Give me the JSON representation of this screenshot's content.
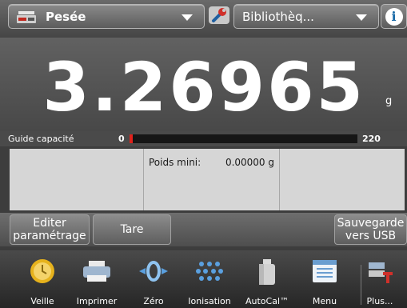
{
  "topbar": {
    "app_label": "Pesée",
    "library_label": "Bibliothèq...",
    "wrench_icon": "wrench-icon",
    "info_icon": "info-icon",
    "info_glyph": "i"
  },
  "weight": {
    "value": "3.26965",
    "unit": "g"
  },
  "capacity": {
    "label": "Guide capacité",
    "min": "0",
    "max": "220",
    "fill_fraction": 0.015,
    "fill_color": "#e0221c"
  },
  "info_panel": {
    "min_weight_label": "Poids mini:",
    "min_weight_value": "0.00000 g"
  },
  "softkeys": {
    "edit_line1": "Editer",
    "edit_line2": "paramétrage",
    "tare": "Tare",
    "save_line1": "Sauvegarde",
    "save_line2": "vers USB"
  },
  "dock": {
    "items": [
      {
        "label": "Veille",
        "icon": "standby-icon"
      },
      {
        "label": "Imprimer",
        "icon": "printer-icon"
      },
      {
        "label": "Zéro",
        "icon": "zero-icon"
      },
      {
        "label": "Ionisation",
        "icon": "ionizer-icon"
      },
      {
        "label": "AutoCal™",
        "icon": "calibration-weight-icon"
      },
      {
        "label": "Menu",
        "icon": "menu-icon"
      },
      {
        "label": "Plus...",
        "icon": "more-icon"
      }
    ]
  }
}
